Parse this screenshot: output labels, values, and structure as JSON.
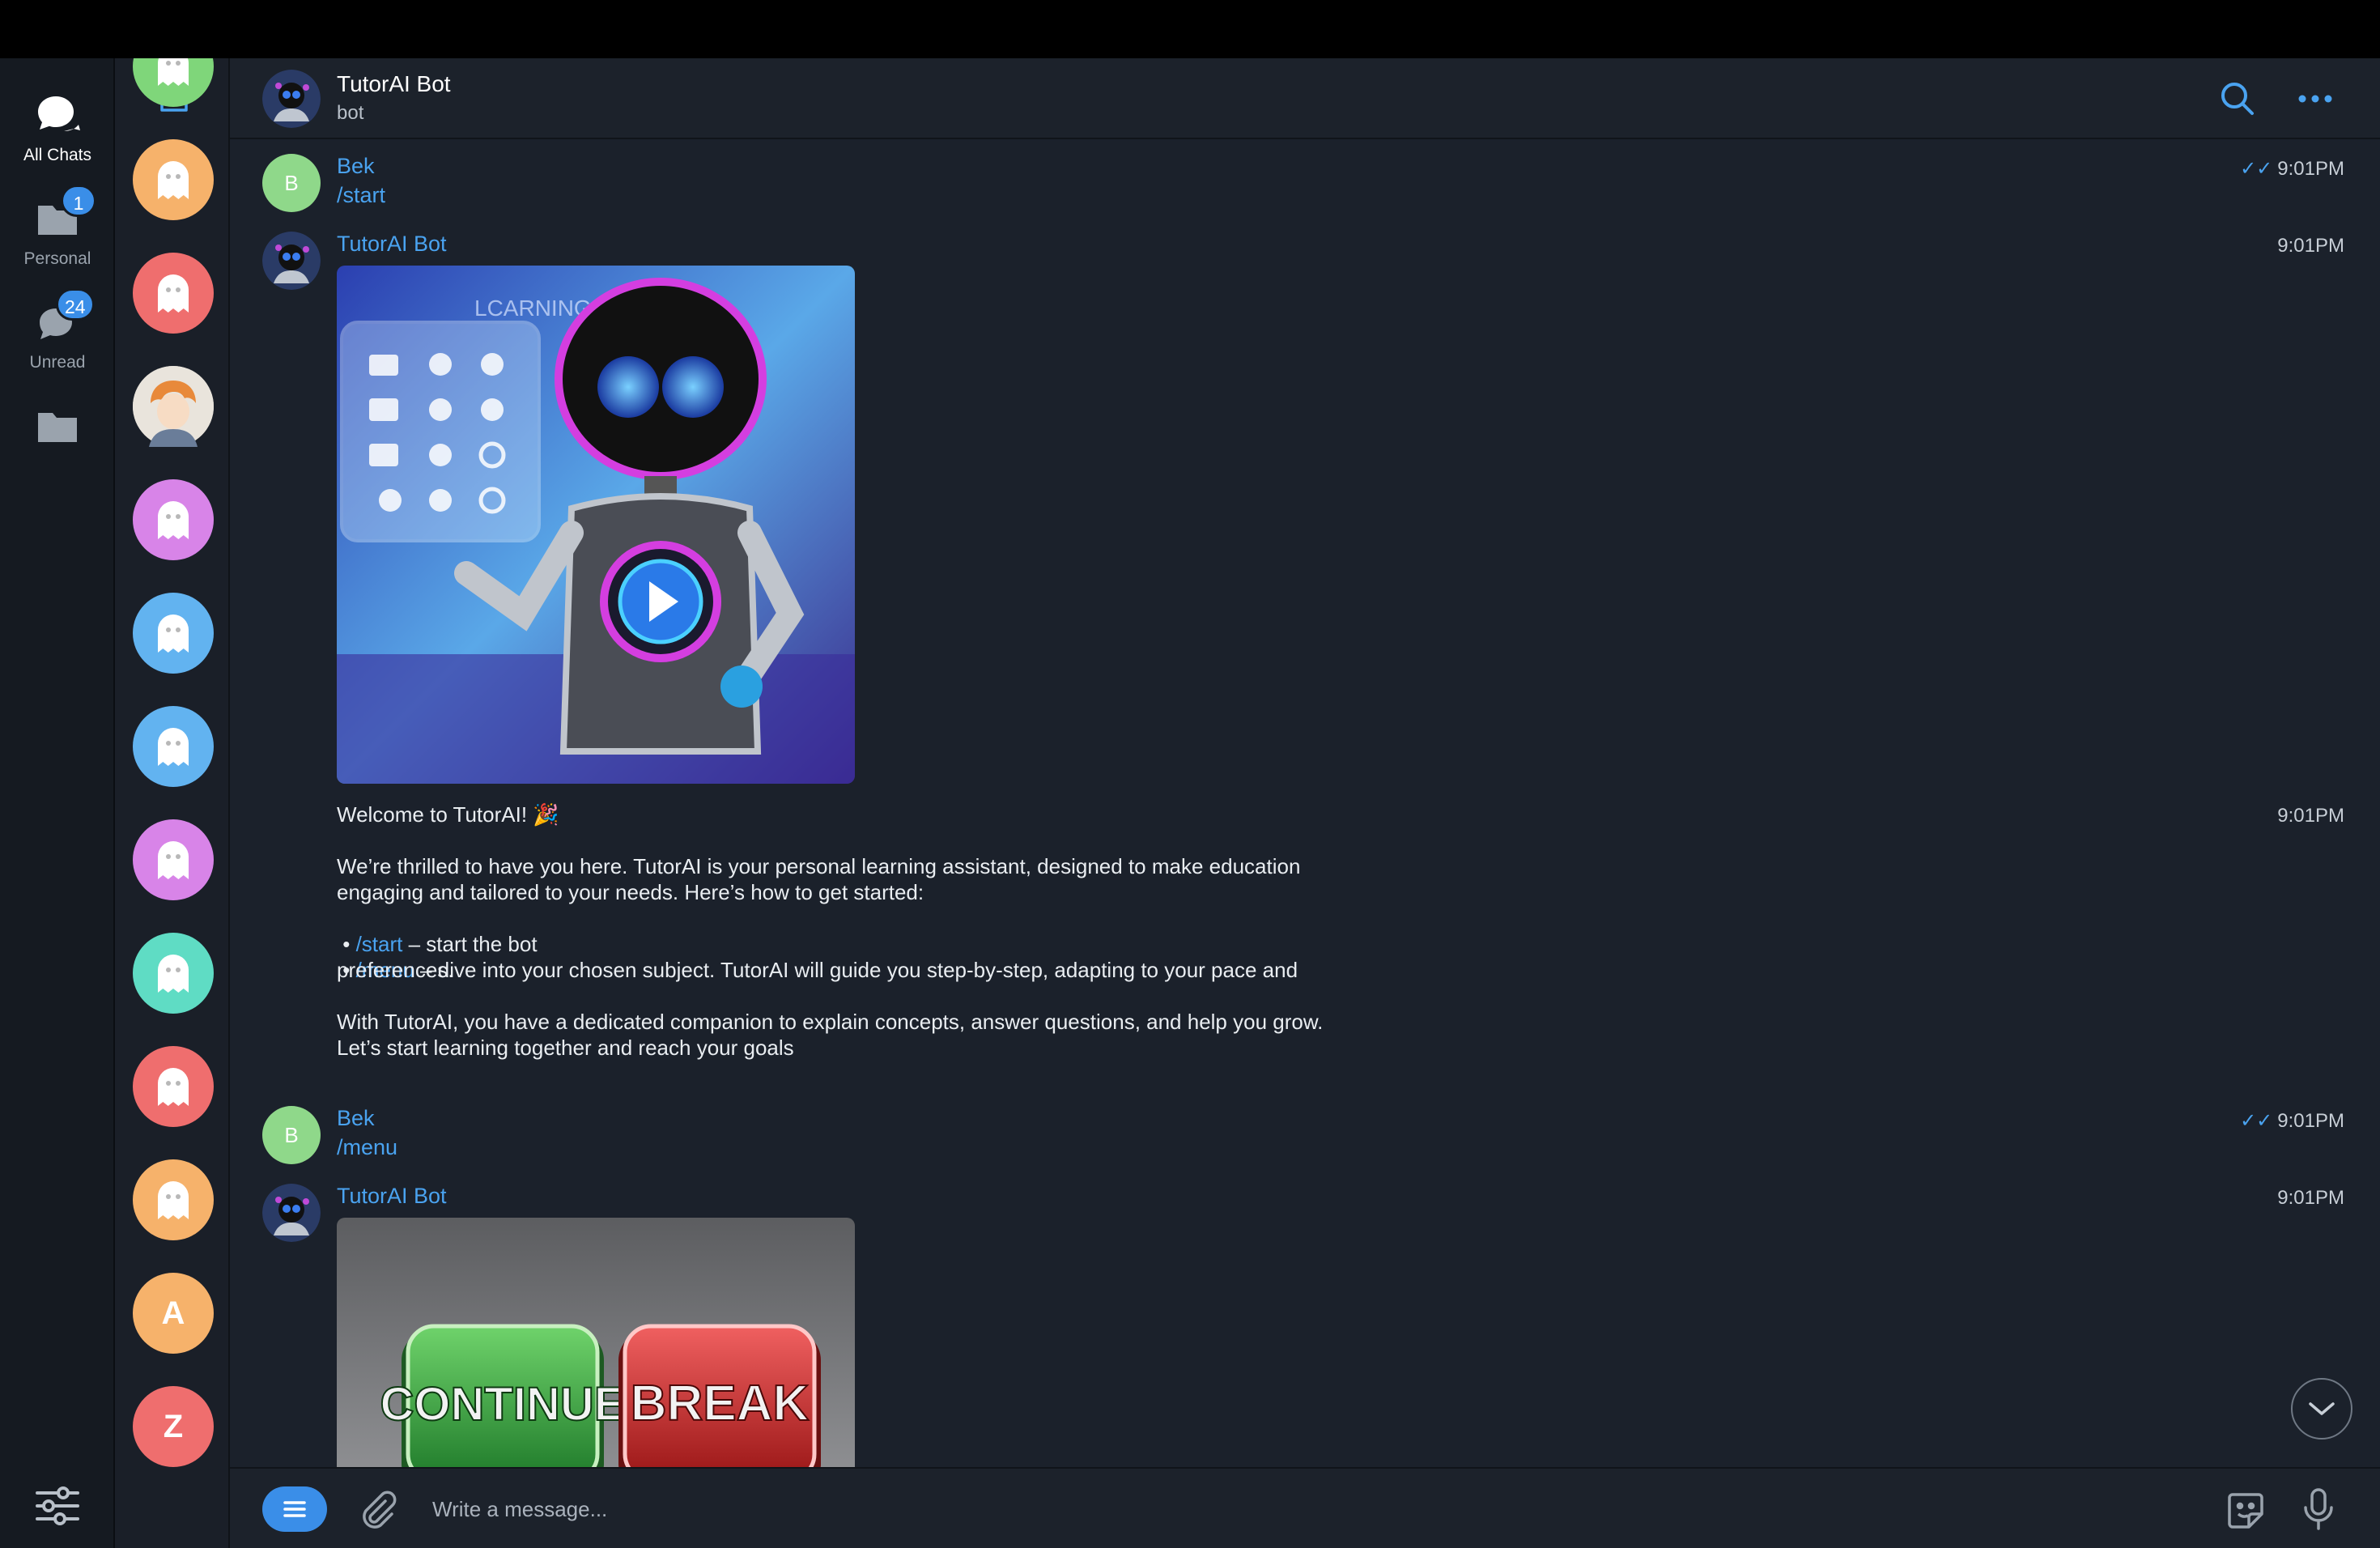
{
  "rail": {
    "folders": [
      {
        "label": "All Chats",
        "icon": "chats-icon",
        "active": true
      },
      {
        "label": "Personal",
        "icon": "folder-icon",
        "badge": "1"
      },
      {
        "label": "Unread",
        "icon": "chat-bubble-icon",
        "badge": "24"
      },
      {
        "label": "",
        "icon": "folder-icon"
      }
    ],
    "settings_icon": "sliders-icon"
  },
  "chat_list": {
    "compose_icon": "compose-icon",
    "avatars": [
      {
        "kind": "ghost",
        "color": "#7fd67a"
      },
      {
        "kind": "ghost",
        "color": "#f6b26b"
      },
      {
        "kind": "ghost",
        "color": "#ef6e6e"
      },
      {
        "kind": "photo",
        "color": "#d8d2c8"
      },
      {
        "kind": "ghost",
        "color": "#d884e8"
      },
      {
        "kind": "ghost",
        "color": "#62b3f0"
      },
      {
        "kind": "ghost",
        "color": "#62b3f0"
      },
      {
        "kind": "ghost",
        "color": "#d884e8"
      },
      {
        "kind": "ghost",
        "color": "#5fdcc4"
      },
      {
        "kind": "ghost",
        "color": "#ef6e6e"
      },
      {
        "kind": "ghost",
        "color": "#f6b26b"
      },
      {
        "kind": "letter",
        "letter": "A",
        "color": "#f6b26b"
      },
      {
        "kind": "letter",
        "letter": "Z",
        "color": "#ef6e6e"
      }
    ]
  },
  "header": {
    "title": "TutorAI Bot",
    "subtitle": "bot"
  },
  "messages": {
    "m1": {
      "sender": "Bek",
      "avatar_letter": "B",
      "text": "/start",
      "time": "9:01PM",
      "ticks": "✓✓"
    },
    "m2": {
      "sender": "TutorAI Bot",
      "time": "9:01PM",
      "image_text": "LCARNING"
    },
    "m3": {
      "time": "9:01PM",
      "line1": "Welcome to TutorAI! 🎉",
      "para1": "We’re thrilled to have you here. TutorAI is your personal learning assistant, designed to make education\nengaging and tailored to your needs. Here’s how to get started:",
      "b1_cmd": "/start",
      "b1_text": " – start the bot",
      "b2_cmd": "/menu",
      "b2_text": " – dive into your chosen subject. TutorAI will guide you step-by-step, adapting to your pace and",
      "b2_cont": "preferences.",
      "para2": "With TutorAI, you have a dedicated companion to explain concepts, answer questions, and help you grow.\nLet’s start learning together and reach your goals"
    },
    "m4": {
      "sender": "Bek",
      "avatar_letter": "B",
      "text": "/menu",
      "time": "9:01PM",
      "ticks": "✓✓"
    },
    "m5": {
      "sender": "TutorAI Bot",
      "time": "9:01PM",
      "btn1": "CONTINUE",
      "btn2": "BREAK"
    }
  },
  "composer": {
    "placeholder": "Write a message..."
  },
  "colors": {
    "accent": "#3a8ee8",
    "link": "#4aa3f0",
    "bg": "#1b212b"
  }
}
